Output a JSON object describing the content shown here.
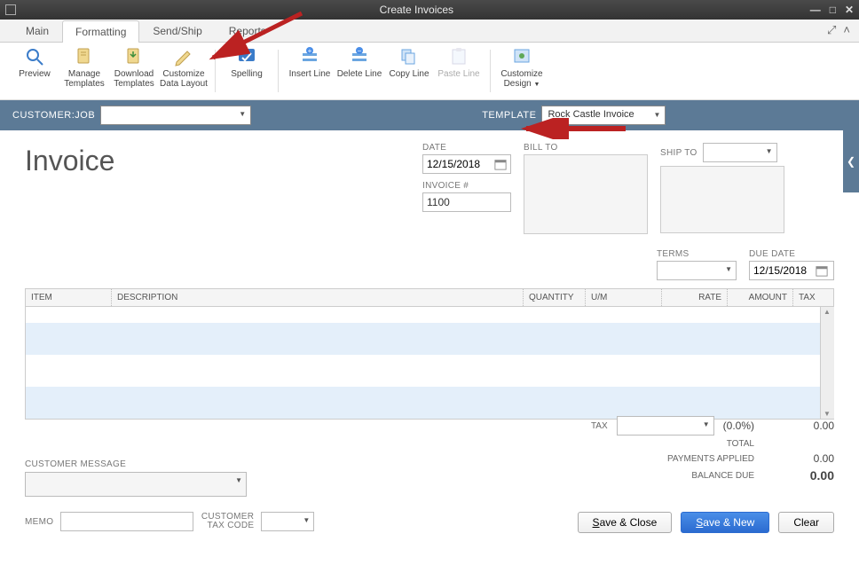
{
  "window": {
    "title": "Create Invoices"
  },
  "tabs": {
    "main": "Main",
    "formatting": "Formatting",
    "sendship": "Send/Ship",
    "reports": "Reports"
  },
  "ribbon": {
    "preview": "Preview",
    "manage_templates": "Manage Templates",
    "download_templates": "Download Templates",
    "customize_layout": "Customize Data Layout",
    "spelling": "Spelling",
    "insert_line": "Insert Line",
    "delete_line": "Delete Line",
    "copy_line": "Copy Line",
    "paste_line": "Paste Line",
    "customize_design": "Customize Design"
  },
  "customer_bar": {
    "customer_label": "CUSTOMER:JOB",
    "template_label": "TEMPLATE",
    "template_value": "Rock Castle Invoice"
  },
  "invoice": {
    "heading": "Invoice",
    "date_label": "DATE",
    "date_value": "12/15/2018",
    "billto_label": "BILL TO",
    "shipto_label": "SHIP TO",
    "invoice_num_label": "INVOICE #",
    "invoice_num_value": "1100",
    "terms_label": "TERMS",
    "due_date_label": "DUE DATE",
    "due_date_value": "12/15/2018"
  },
  "grid_headers": {
    "item": "ITEM",
    "desc": "DESCRIPTION",
    "qty": "QUANTITY",
    "um": "U/M",
    "rate": "RATE",
    "amount": "AMOUNT",
    "tax": "TAX"
  },
  "totals": {
    "tax_label": "TAX",
    "tax_pct": "(0.0%)",
    "tax_amt": "0.00",
    "total_label": "TOTAL",
    "payments_label": "PAYMENTS APPLIED",
    "payments_amt": "0.00",
    "balance_label": "BALANCE DUE",
    "balance_amt": "0.00"
  },
  "bottom": {
    "cust_msg_label": "CUSTOMER MESSAGE",
    "memo_label": "MEMO",
    "cust_tax_label": "CUSTOMER TAX CODE"
  },
  "buttons": {
    "save_close": "Save & Close",
    "save_new": "Save & New",
    "clear": "Clear"
  }
}
